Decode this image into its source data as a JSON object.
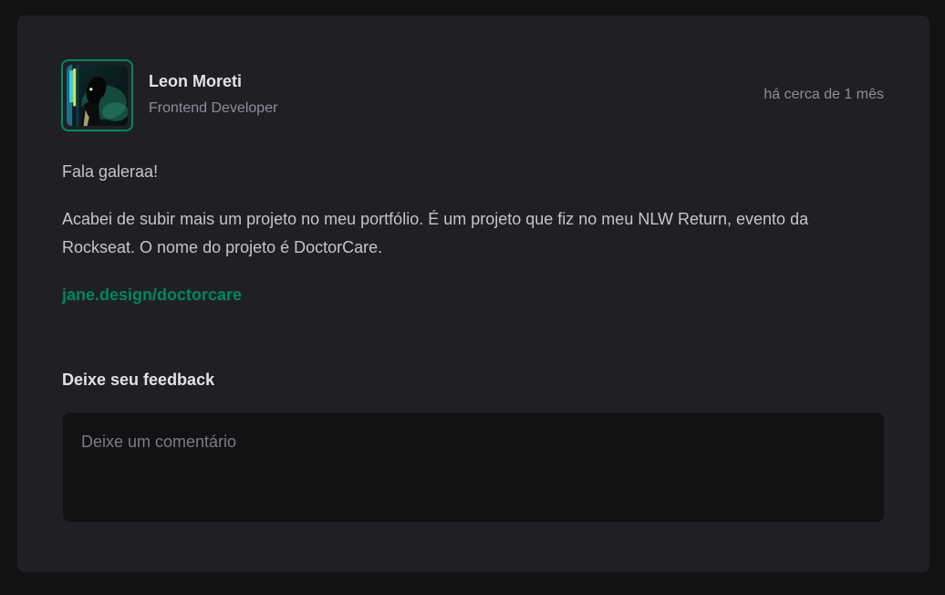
{
  "author": {
    "name": "Leon Moreti",
    "role": "Frontend Developer",
    "avatar_icon": "profile-photo"
  },
  "published_at": "há cerca de 1 mês",
  "content": {
    "paragraphs": [
      "Fala galeraa!",
      "Acabei de subir mais um projeto no meu portfólio. É um projeto que fiz no meu NLW Return, evento da Rockseat. O nome do projeto é DoctorCare."
    ],
    "link": "jane.design/doctorcare"
  },
  "feedback": {
    "title": "Deixe seu feedback",
    "placeholder": "Deixe um comentário",
    "value": ""
  },
  "colors": {
    "background": "#121214",
    "card": "#202024",
    "accent": "#00875f",
    "text_primary": "#e1e1e6",
    "text_body": "#c4c4cc",
    "text_muted": "#8d8d99"
  }
}
